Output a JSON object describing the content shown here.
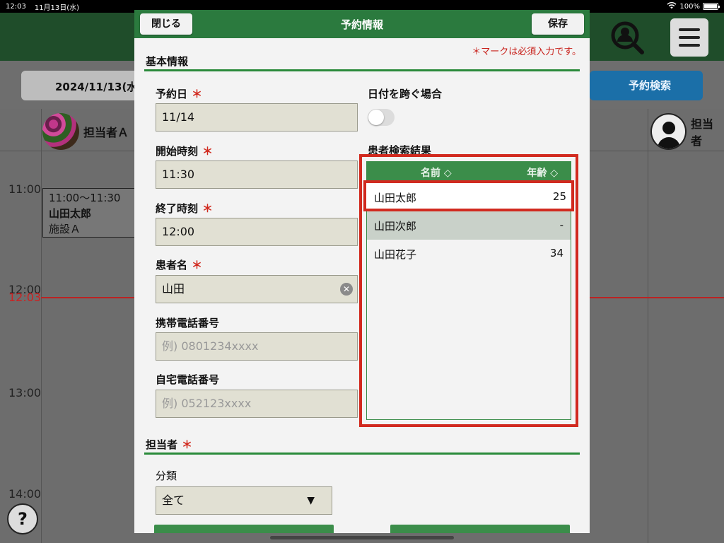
{
  "status_bar": {
    "time": "12:03",
    "date": "11月13日(水)",
    "battery": "100%"
  },
  "background": {
    "date_button": "2024/11/13(水",
    "search_button": "予約検索",
    "staff_a": "担当者Ａ",
    "staff_b": "担当者",
    "times": [
      "11:00",
      "12:00",
      "13:00",
      "14:00"
    ],
    "now_time": "12:03",
    "appointment": {
      "time": "11:00～11:30",
      "name": "山田太郎",
      "facility": "施設Ａ"
    },
    "help": "?"
  },
  "modal": {
    "title": "予約情報",
    "close_label": "閉じる",
    "save_label": "保存",
    "required_note": "＊マークは必須入力です。",
    "basic_section": "基本情報",
    "staff_section": "担当者",
    "fields": {
      "date": {
        "label": "予約日",
        "value": "11/14"
      },
      "start": {
        "label": "開始時刻",
        "value": "11:30"
      },
      "end": {
        "label": "終了時刻",
        "value": "12:00"
      },
      "patient": {
        "label": "患者名",
        "value": "山田"
      },
      "mobile": {
        "label": "携帯電話番号",
        "placeholder": "例) 0801234xxxx"
      },
      "home": {
        "label": "自宅電話番号",
        "placeholder": "例) 052123xxxx"
      }
    },
    "cross_date_label": "日付を跨ぐ場合",
    "results": {
      "label": "患者検索結果",
      "col_name": "名前 ◇",
      "col_age": "年齢 ◇",
      "rows": [
        {
          "name": "山田太郎",
          "age": "25"
        },
        {
          "name": "山田次郎",
          "age": "-"
        },
        {
          "name": "山田花子",
          "age": "34"
        }
      ]
    },
    "category": {
      "label": "分類",
      "value": "全て",
      "arrow": "▼"
    }
  },
  "required_mark": "＊",
  "colors": {
    "accent_green": "#2b7a3e",
    "required_red": "#d12a1f",
    "search_blue": "#1b6fa8"
  }
}
